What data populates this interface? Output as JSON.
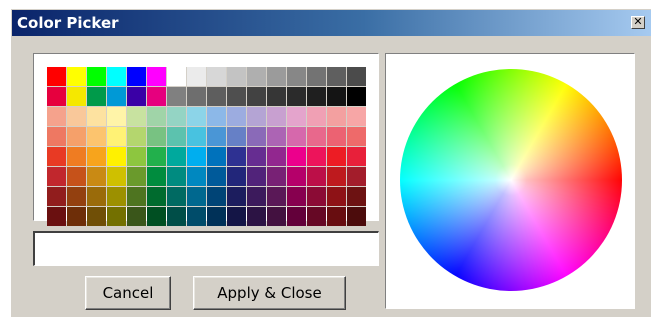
{
  "window": {
    "title": "Color Picker",
    "close_glyph": "✕"
  },
  "palette": {
    "rows": [
      [
        "#ff0000",
        "#ffff00",
        "#00ff00",
        "#00ffff",
        "#0000ff",
        "#ff00ff",
        "#ffffff",
        "#ebebeb",
        "#d7d7d7",
        "#c3c3c3",
        "#afafaf",
        "#9b9b9b",
        "#878787",
        "#737373",
        "#5f5f5f",
        "#4b4b4b"
      ],
      [
        "#e6003e",
        "#f5e800",
        "#009a4a",
        "#0099d6",
        "#3a00a6",
        "#e6007e",
        "#808080",
        "#6e6e6e",
        "#5e5e5e",
        "#4f4f4f",
        "#424242",
        "#363636",
        "#2b2b2b",
        "#1f1f1f",
        "#141414",
        "#000000"
      ],
      [
        "#f5a28c",
        "#f9c89a",
        "#fde2a0",
        "#fff4a8",
        "#c8e2a0",
        "#a0d4a8",
        "#94d4c4",
        "#8cd4e8",
        "#8cb8e8",
        "#9cace0",
        "#b4a4d4",
        "#c8a0d0",
        "#e4a4cc",
        "#f0a0b4",
        "#f3a0a0",
        "#f7a6a6"
      ],
      [
        "#ee7862",
        "#f5a06a",
        "#fcc46e",
        "#fff275",
        "#b4d66e",
        "#78c282",
        "#5cc2ae",
        "#48c2e0",
        "#4a96d6",
        "#6680c6",
        "#8a6ab8",
        "#ac64b4",
        "#d668ac",
        "#e8688c",
        "#ec6272",
        "#ee6a6a"
      ],
      [
        "#e83a24",
        "#ef7c22",
        "#f7a41c",
        "#fff100",
        "#8dc63f",
        "#22b04c",
        "#00a99d",
        "#00aeef",
        "#0072bc",
        "#2e3192",
        "#662d91",
        "#92278f",
        "#ec008c",
        "#ed145b",
        "#ed1c24",
        "#e8203a"
      ],
      [
        "#c1272d",
        "#c6521a",
        "#c98a14",
        "#cfc000",
        "#6a9a2c",
        "#008c3e",
        "#008b80",
        "#0088c0",
        "#005a9a",
        "#22267a",
        "#51237a",
        "#782175",
        "#b5006a",
        "#bc0f48",
        "#be1a1e",
        "#a31d2b"
      ],
      [
        "#911d1d",
        "#93400f",
        "#9a6b0a",
        "#9c9000",
        "#4e7420",
        "#006b2e",
        "#006a62",
        "#00688f",
        "#004476",
        "#1c1d5e",
        "#3c1a5c",
        "#5a1857",
        "#87004f",
        "#8b0b35",
        "#8e1216",
        "#6d1212"
      ],
      [
        "#6a1010",
        "#6e2e08",
        "#704f06",
        "#737000",
        "#3a561a",
        "#004f22",
        "#004e48",
        "#004c6a",
        "#003158",
        "#141546",
        "#2c1344",
        "#431140",
        "#63003a",
        "#660825",
        "#680d10",
        "#4c0c0c"
      ]
    ]
  },
  "color_input": {
    "value": "",
    "placeholder": ""
  },
  "buttons": {
    "cancel": "Cancel",
    "apply": "Apply & Close"
  }
}
